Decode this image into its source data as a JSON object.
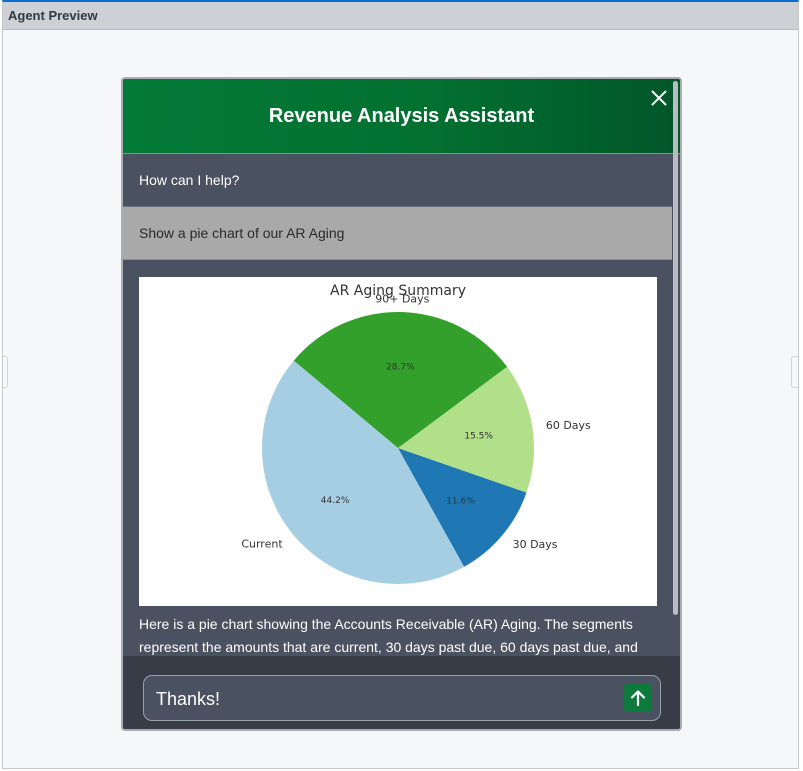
{
  "window": {
    "title": "Agent Preview"
  },
  "header": {
    "title": "Revenue Analysis Assistant"
  },
  "messages": [
    {
      "role": "assistant",
      "text": "How can I help?"
    },
    {
      "role": "user",
      "text": "Show a pie chart of our AR Aging"
    }
  ],
  "response": {
    "text": "Here is a pie chart showing the Accounts Receivable (AR) Aging. The segments represent the amounts that are current, 30 days past due, 60 days past due, and"
  },
  "input": {
    "value": "Thanks!"
  },
  "icons": {
    "close": "close-icon",
    "send": "arrow-up-icon"
  },
  "colors": {
    "accent": "#047a37",
    "send": "#0d7a3b"
  },
  "chart_data": {
    "type": "pie",
    "title": "AR Aging Summary",
    "categories": [
      "Current",
      "30 Days",
      "60 Days",
      "90+ Days"
    ],
    "values": [
      44.2,
      11.6,
      15.5,
      28.7
    ],
    "labels": [
      "44.2%",
      "11.6%",
      "15.5%",
      "28.7%"
    ],
    "colors": [
      "#a6cee3",
      "#1f78b4",
      "#b2df8a",
      "#33a02c"
    ],
    "startangle": 140,
    "direction": "counterclockwise"
  }
}
